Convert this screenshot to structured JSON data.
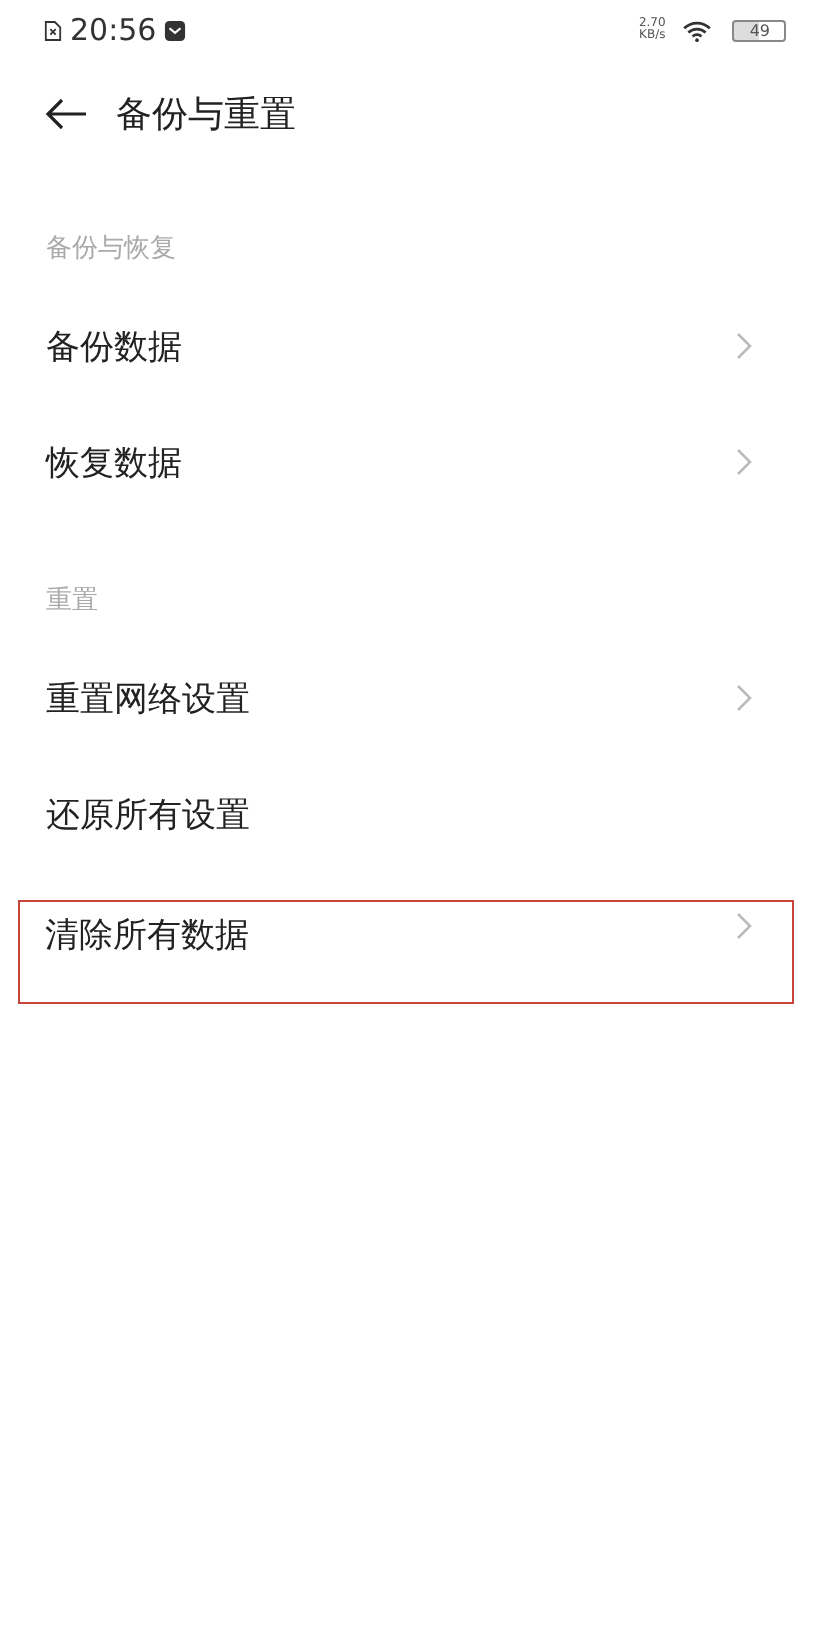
{
  "status_bar": {
    "time": "20:56",
    "speed_value": "2.70",
    "speed_unit": "KB/s",
    "battery": "49"
  },
  "title": "备份与重置",
  "sections": [
    {
      "header": "备份与恢复",
      "items": [
        {
          "label": "备份数据",
          "chevron": true,
          "highlighted": false
        },
        {
          "label": "恢复数据",
          "chevron": true,
          "highlighted": false
        }
      ]
    },
    {
      "header": "重置",
      "items": [
        {
          "label": "重置网络设置",
          "chevron": true,
          "highlighted": false
        },
        {
          "label": "还原所有设置",
          "chevron": false,
          "highlighted": false
        },
        {
          "label": "清除所有数据",
          "chevron": true,
          "highlighted": true
        }
      ]
    }
  ]
}
